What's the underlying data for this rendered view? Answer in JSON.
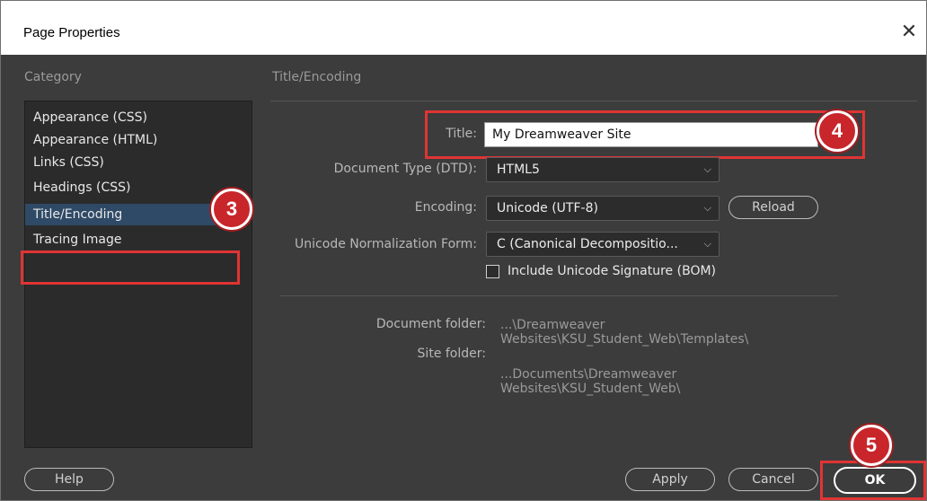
{
  "window": {
    "title": "Page Properties",
    "close_glyph": "✕"
  },
  "category": {
    "header": "Category",
    "items": [
      "Appearance (CSS)",
      "Appearance (HTML)",
      "Links (CSS)",
      "Headings (CSS)",
      "Title/Encoding",
      "Tracing Image"
    ],
    "selected_index": 4
  },
  "section": {
    "header": "Title/Encoding"
  },
  "form": {
    "title_label": "Title:",
    "title_value": "My Dreamweaver Site",
    "doctype_label": "Document Type (DTD):",
    "doctype_value": "HTML5",
    "encoding_label": "Encoding:",
    "encoding_value": "Unicode (UTF-8)",
    "reload_label": "Reload",
    "normalization_label": "Unicode Normalization Form:",
    "normalization_value": "C (Canonical Decompositio...",
    "bom_label": "Include Unicode Signature (BOM)",
    "bom_checked": false
  },
  "info": {
    "document_folder_label": "Document folder:",
    "document_folder_value": "...\\Dreamweaver Websites\\KSU_Student_Web\\Templates\\",
    "site_folder_label": "Site folder:",
    "site_folder_value": "...Documents\\Dreamweaver Websites\\KSU_Student_Web\\"
  },
  "buttons": {
    "help": "Help",
    "apply": "Apply",
    "cancel": "Cancel",
    "ok": "OK"
  },
  "annotations": {
    "badge3": "3",
    "badge4": "4",
    "badge5": "5"
  },
  "icons": {
    "dropdown": "chevron-down-icon",
    "close": "close-icon"
  },
  "colors": {
    "dialog_bg": "#3c3c3c",
    "list_bg": "#2b2b2b",
    "selected_bg": "#2f4a66",
    "highlight_red": "#e03434",
    "badge_red": "#c8262b"
  }
}
